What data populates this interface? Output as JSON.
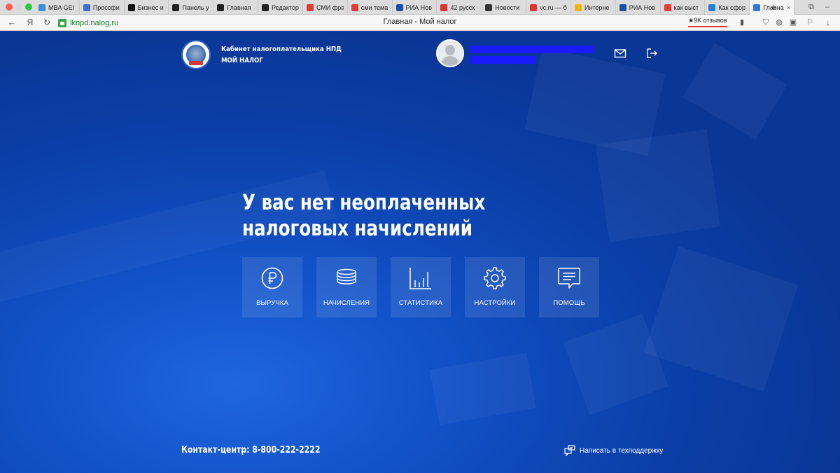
{
  "browser": {
    "tabs": [
      {
        "title": "MBA GEI",
        "favicon": "snowflake-icon",
        "color": "#3b8fd8"
      },
      {
        "title": "Прессфи",
        "favicon": "pf-icon",
        "color": "#3b6fd8"
      },
      {
        "title": "Бизнес и",
        "favicon": "dv-icon",
        "color": "#111111"
      },
      {
        "title": "Панель у",
        "favicon": "wix-icon",
        "color": "#222222"
      },
      {
        "title": "Главная",
        "favicon": "wix-icon",
        "color": "#222222"
      },
      {
        "title": "Редактор",
        "favicon": "wix-icon",
        "color": "#222222"
      },
      {
        "title": "СМИ фра",
        "favicon": "yandex-icon",
        "color": "#e53935"
      },
      {
        "title": "сми тема",
        "favicon": "yandex-icon",
        "color": "#e53935"
      },
      {
        "title": "РИА Нов",
        "favicon": "ria-icon",
        "color": "#1c4fa0"
      },
      {
        "title": "42 русск",
        "favicon": "vc-icon",
        "color": "#d33"
      },
      {
        "title": "Новости",
        "favicon": "m-icon",
        "color": "#333"
      },
      {
        "title": "vc.ru — б",
        "favicon": "vc-icon",
        "color": "#d33"
      },
      {
        "title": "Интерне",
        "favicon": "c-icon",
        "color": "#f5b400"
      },
      {
        "title": "РИА Нов",
        "favicon": "ria-icon",
        "color": "#1c4fa0"
      },
      {
        "title": "как выст",
        "favicon": "yandex-icon",
        "color": "#e53935"
      },
      {
        "title": "Как сфор",
        "favicon": "chart-icon",
        "color": "#2a7bd5"
      },
      {
        "title": "Главна",
        "favicon": "globe-icon",
        "color": "#2a7bd5",
        "active": true
      }
    ],
    "url": "lknpd.nalog.ru",
    "page_title": "Главная - Мой налог",
    "reviews_label": "9K отзывов"
  },
  "header": {
    "brand_line1": "Кабинет налогоплательщика НПД",
    "brand_line2": "МОЙ НАЛОГ"
  },
  "main": {
    "headline": "У вас нет неоплаченных налоговых начислений",
    "tiles": [
      {
        "label": "ВЫРУЧКА",
        "icon": "ruble-icon"
      },
      {
        "label": "НАЧИСЛЕНИЯ",
        "icon": "coins-stack-icon"
      },
      {
        "label": "СТАТИСТИКА",
        "icon": "bar-chart-icon"
      },
      {
        "label": "НАСТРОЙКИ",
        "icon": "gear-icon"
      },
      {
        "label": "ПОМОЩЬ",
        "icon": "help-chat-icon"
      }
    ]
  },
  "footer": {
    "contact": "Контакт-центр: 8-800-222-2222",
    "support_link": "Написать в техподдержку"
  },
  "colors": {
    "page_bg": "#0d3fa6",
    "redaction": "#1a1aff"
  }
}
